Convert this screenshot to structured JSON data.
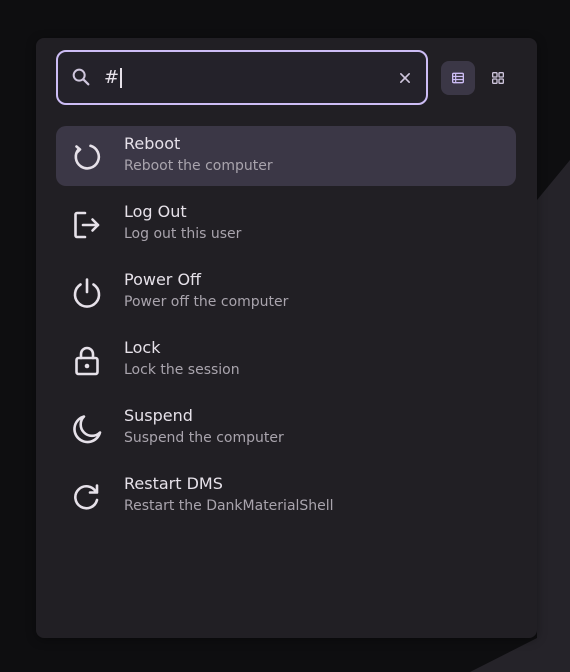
{
  "search": {
    "value": "#",
    "icon": "search-icon",
    "clear_icon": "close-icon",
    "accent": "#cdbdf5"
  },
  "view_modes": [
    {
      "name": "list-view",
      "icon": "list-icon",
      "active": true
    },
    {
      "name": "grid-view",
      "icon": "grid-icon",
      "active": false
    }
  ],
  "items": [
    {
      "title": "Reboot",
      "description": "Reboot the computer",
      "icon": "reboot-icon",
      "selected": true
    },
    {
      "title": "Log Out",
      "description": "Log out this user",
      "icon": "logout-icon",
      "selected": false
    },
    {
      "title": "Power Off",
      "description": "Power off the computer",
      "icon": "power-icon",
      "selected": false
    },
    {
      "title": "Lock",
      "description": "Lock the session",
      "icon": "lock-icon",
      "selected": false
    },
    {
      "title": "Suspend",
      "description": "Suspend the computer",
      "icon": "moon-icon",
      "selected": false
    },
    {
      "title": "Restart DMS",
      "description": "Restart the DankMaterialShell",
      "icon": "restart-icon",
      "selected": false
    }
  ],
  "colors": {
    "surface": "#211f24",
    "selected": "#3b3746",
    "text": "#e6e1e9",
    "subtext": "#a9a4ad"
  }
}
